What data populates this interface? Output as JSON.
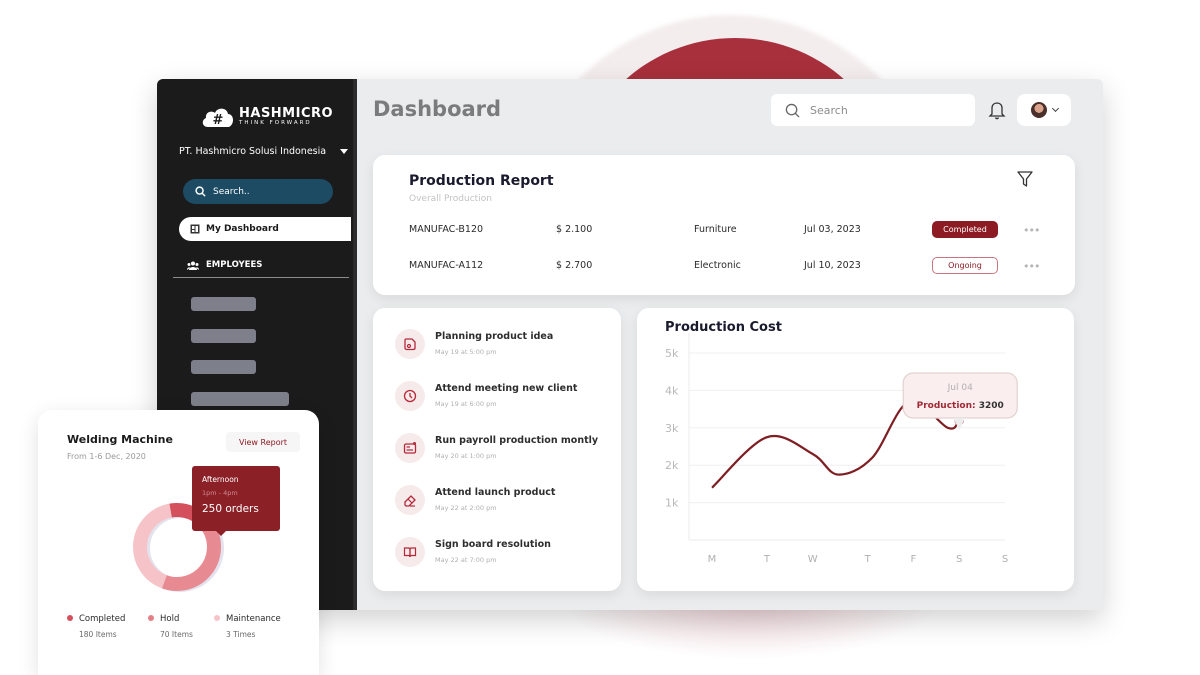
{
  "brand": {
    "name": "HASHMICRO",
    "tagline": "THINK FORWARD"
  },
  "sidebar": {
    "company": "PT. Hashmicro Solusi Indonesia",
    "search_placeholder": "Search..",
    "active_item": "My Dashboard",
    "section": "EMPLOYEES"
  },
  "header": {
    "title": "Dashboard",
    "search_placeholder": "Search"
  },
  "report": {
    "title": "Production Report",
    "subtitle": "Overall Production",
    "rows": [
      {
        "code": "MANUFAC-B120",
        "amount": "$ 2.100",
        "category": "Furniture",
        "date": "Jul 03, 2023",
        "status": "Completed"
      },
      {
        "code": "MANUFAC-A112",
        "amount": "$ 2.700",
        "category": "Electronic",
        "date": "Jul 10, 2023",
        "status": "Ongoing"
      }
    ]
  },
  "tasks": [
    {
      "title": "Planning product idea",
      "time": "May 19 at 5:00 pm",
      "icon": "note-icon"
    },
    {
      "title": "Attend meeting new client",
      "time": "May 19 at 6:00 pm",
      "icon": "clock-icon"
    },
    {
      "title": "Run payroll production montly",
      "time": "May 20 at 1:00 pm",
      "icon": "payroll-icon"
    },
    {
      "title": "Attend launch product",
      "time": "May 22 at 2:00 pm",
      "icon": "eraser-icon"
    },
    {
      "title": "Sign board resolution",
      "time": "May 22 at 7:00 pm",
      "icon": "book-icon"
    }
  ],
  "welding": {
    "title": "Welding Machine",
    "subtitle": "From 1-6 Dec, 2020",
    "view_report": "View Report",
    "tooltip": {
      "label": "Afternoon",
      "time": "1pm - 4pm",
      "value": "250 orders"
    },
    "legend": [
      {
        "label": "Completed",
        "value": "180 Items",
        "color": "#d4505c"
      },
      {
        "label": "Hold",
        "value": "70 Items",
        "color": "#e57f87"
      },
      {
        "label": "Maintenance",
        "value": "3 Times",
        "color": "#f6c4c8"
      }
    ]
  },
  "chart_data": {
    "type": "line",
    "title": "Production Cost",
    "categories": [
      "M",
      "T",
      "W",
      "T",
      "F",
      "S",
      "S"
    ],
    "x_positions": [
      0,
      1.2,
      2.2,
      3.4,
      4.4,
      5.4,
      6.4
    ],
    "series": [
      {
        "name": "Production",
        "color": "#7e1d22",
        "points": [
          [
            0,
            1400
          ],
          [
            1.2,
            2750
          ],
          [
            2.2,
            2300
          ],
          [
            2.75,
            1750
          ],
          [
            3.5,
            2200
          ],
          [
            4.3,
            3700
          ],
          [
            5.15,
            3000
          ],
          [
            5.4,
            3200
          ],
          [
            5.6,
            3700
          ]
        ]
      }
    ],
    "yticks": [
      "1k",
      "2k",
      "3k",
      "4k",
      "5k"
    ],
    "ylim": [
      0,
      5000
    ],
    "grid": true,
    "tooltip": {
      "label": "Jul 04",
      "series": "Production:",
      "value": "3200",
      "x": 5.4,
      "y": 3200
    },
    "donut": {
      "segments": [
        {
          "name": "Completed",
          "value": 180,
          "color": "#d4505c"
        },
        {
          "name": "Hold",
          "value": 70,
          "color": "#e88a91"
        },
        {
          "name": "Maintenance",
          "value": 3,
          "color": "#f6c4c8"
        }
      ]
    }
  }
}
